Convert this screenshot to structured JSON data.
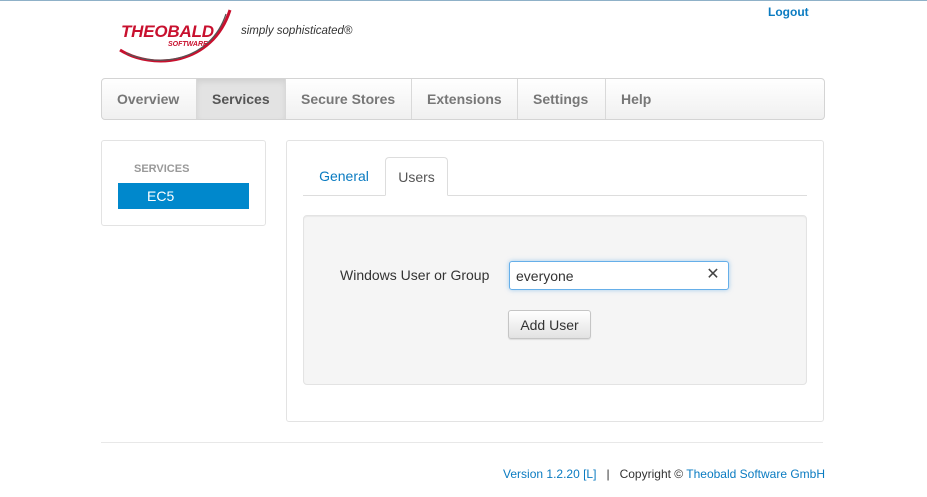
{
  "header": {
    "logo": {
      "brand": "THEOBALD",
      "sub": "SOFTWARE",
      "tagline": "simply sophisticated®",
      "swoosh_color": "#c8102e"
    },
    "logout_label": "Logout"
  },
  "nav": {
    "items": [
      {
        "label": "Overview",
        "active": false
      },
      {
        "label": "Services",
        "active": true
      },
      {
        "label": "Secure Stores",
        "active": false
      },
      {
        "label": "Extensions",
        "active": false
      },
      {
        "label": "Settings",
        "active": false
      },
      {
        "label": "Help",
        "active": false
      }
    ]
  },
  "sidebar": {
    "heading": "SERVICES",
    "items": [
      {
        "label": "EC5",
        "selected": true
      }
    ]
  },
  "main": {
    "tabs": [
      {
        "label": "General",
        "active": false
      },
      {
        "label": "Users",
        "active": true
      }
    ],
    "form": {
      "field_label": "Windows User or Group",
      "field_value": "everyone",
      "clear_icon": "close-icon",
      "add_button_label": "Add User"
    }
  },
  "footer": {
    "version": "Version 1.2.20 [L]",
    "separator": "|",
    "copyright": "Copyright ©",
    "company": "Theobald Software GmbH"
  },
  "colors": {
    "accent": "#0088cc",
    "link": "#0a7bc1",
    "brand_red": "#c8102e"
  }
}
